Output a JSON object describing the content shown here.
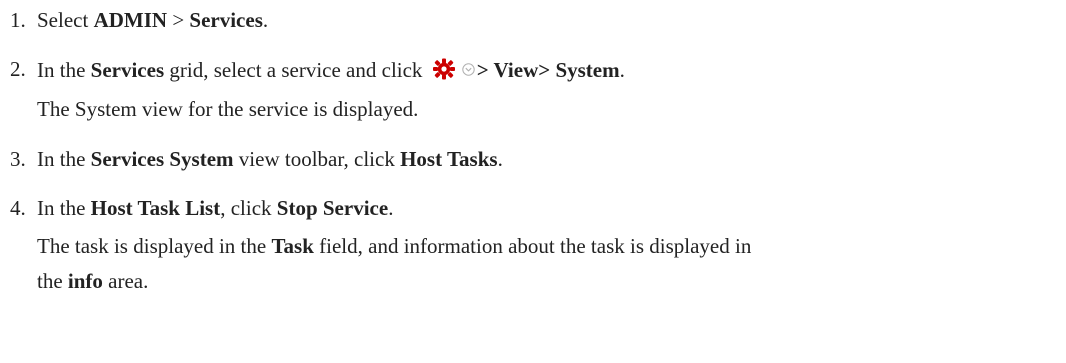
{
  "steps": [
    {
      "number": "1.",
      "select": "Select ",
      "admin": "ADMIN",
      "gt": " > ",
      "services": "Services",
      "end": "."
    },
    {
      "number": "2.",
      "in_the": "In the ",
      "services": "Services",
      "grid_text": " grid, select a service and click ",
      "view": "> View> System",
      "end": ".",
      "result": "The System view for the service is displayed."
    },
    {
      "number": "3.",
      "in_the": "In the ",
      "services_system": "Services System",
      "toolbar_text": " view toolbar, click ",
      "host_tasks": "Host Tasks",
      "end": "."
    },
    {
      "number": "4.",
      "in_the": "In the ",
      "host_task_list": "Host Task List",
      "click": ", click ",
      "stop_service": "Stop Service",
      "end": ".",
      "result_a": "The task is displayed in the ",
      "task": "Task",
      "result_b": " field, and information about the task is displayed in",
      "result_c": "the ",
      "info": "info",
      "result_d": " area."
    }
  ],
  "icons": {
    "gear": "gear-icon",
    "dropdown": "chevron-down-icon",
    "gear_color": "#cc0000",
    "dropdown_color": "#b0b0b0"
  }
}
